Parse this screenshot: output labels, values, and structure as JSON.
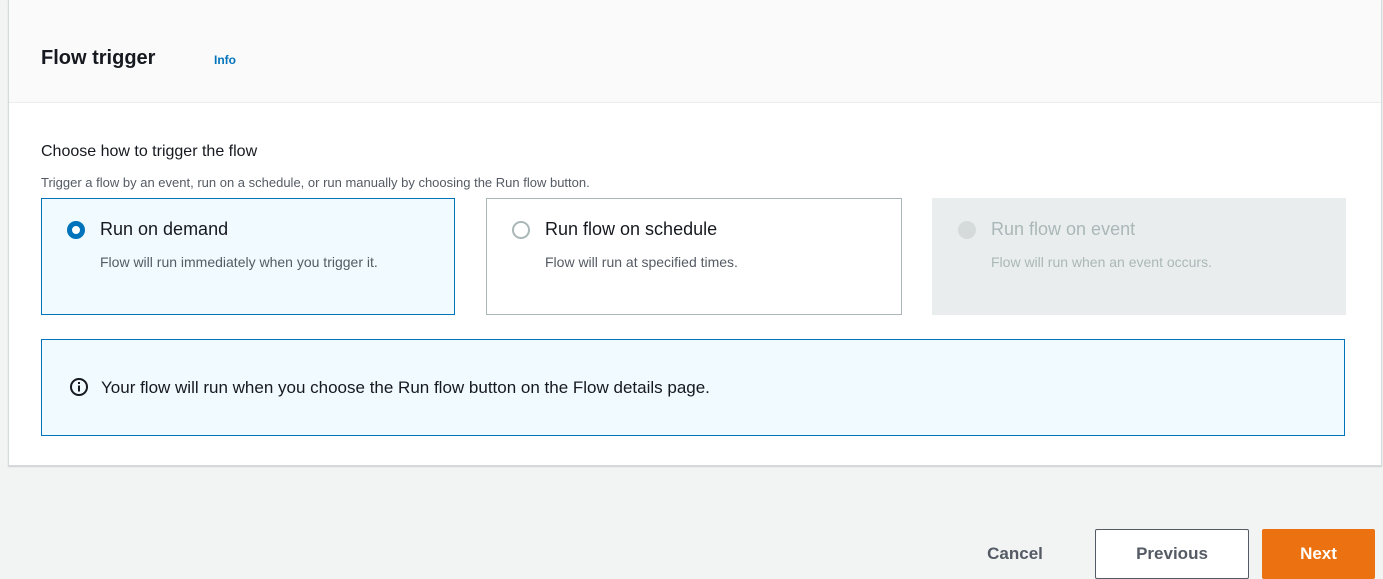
{
  "header": {
    "title": "Flow trigger",
    "info_link": "Info"
  },
  "trigger_field": {
    "label": "Choose how to trigger the flow",
    "description": "Trigger a flow by an event, run on a schedule, or run manually by choosing the Run flow button.",
    "options": [
      {
        "title": "Run on demand",
        "description": "Flow will run immediately when you trigger it.",
        "selected": true,
        "disabled": false
      },
      {
        "title": "Run flow on schedule",
        "description": "Flow will run at specified times.",
        "selected": false,
        "disabled": false
      },
      {
        "title": "Run flow on event",
        "description": "Flow will run when an event occurs.",
        "selected": false,
        "disabled": true
      }
    ]
  },
  "alert": {
    "icon": "info-icon",
    "text": "Your flow will run when you choose the Run flow button on the Flow details page."
  },
  "footer": {
    "cancel_label": "Cancel",
    "previous_label": "Previous",
    "next_label": "Next"
  },
  "colors": {
    "accent": "#0073bb",
    "primary_button": "#ec7211",
    "page_background": "#f2f3f3"
  }
}
